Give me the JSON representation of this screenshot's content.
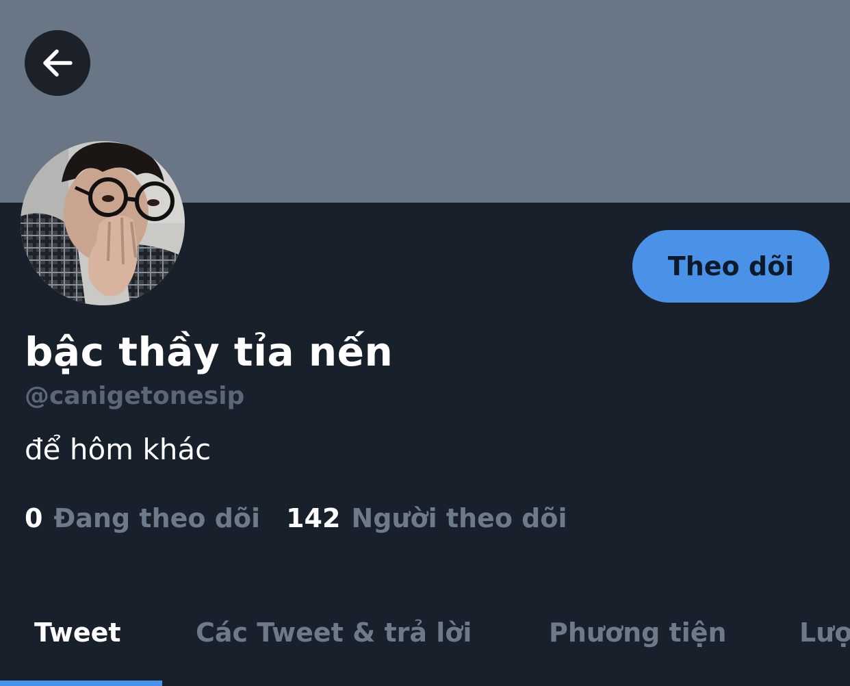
{
  "header": {
    "back_icon": "arrow-left-icon"
  },
  "profile": {
    "display_name": "bậc thầy tỉa nến",
    "handle": "@canigetonesip",
    "bio": "để hôm khác",
    "follow_label": "Theo dõi"
  },
  "stats": [
    {
      "count": "0",
      "label": "Đang theo dõi"
    },
    {
      "count": "142",
      "label": "Người theo dõi"
    }
  ],
  "tabs": [
    {
      "label": "Tweet",
      "active": true
    },
    {
      "label": "Các Tweet & trả lời",
      "active": false
    },
    {
      "label": "Phương tiện",
      "active": false
    },
    {
      "label": "Lượt thích",
      "active": false
    }
  ],
  "colors": {
    "background": "#18202b",
    "banner": "#697685",
    "accent": "#4a92e8",
    "muted_text": "#6d7a8a"
  }
}
